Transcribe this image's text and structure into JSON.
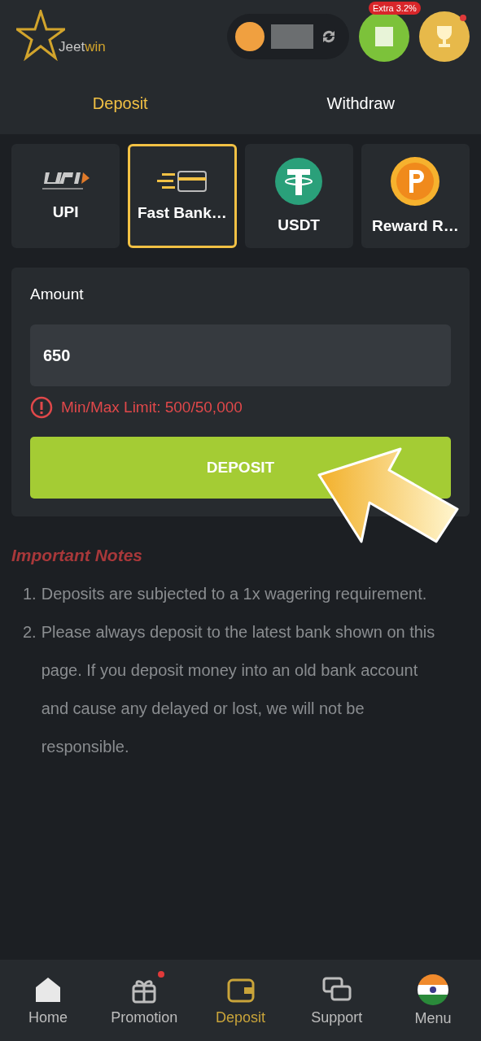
{
  "header": {
    "logo": {
      "part_1": "Jeet",
      "part_2": "win"
    },
    "badge": "Extra 3.2%"
  },
  "tabs": [
    {
      "label": "Deposit",
      "selected": true
    },
    {
      "label": "Withdraw",
      "selected": false
    }
  ],
  "methods": [
    {
      "kind": "upi",
      "label": "UPI",
      "selected": false
    },
    {
      "kind": "bank",
      "label": "Fast Bank…",
      "selected": true
    },
    {
      "kind": "usdt",
      "label": "USDT",
      "selected": false
    },
    {
      "kind": "reward",
      "label": "Reward R…",
      "selected": false
    }
  ],
  "form": {
    "label": "Amount",
    "value": "650",
    "error": "Min/Max Limit: 500/50,000",
    "button": "DEPOSIT"
  },
  "notes": {
    "title": "Important Notes",
    "items": [
      {
        "number": "1.",
        "text": "Deposits are subjected to a 1x wagering requirement."
      },
      {
        "number": "2.",
        "text": "Please always deposit to the latest bank shown on this page. If you deposit money into an old bank account and cause any delayed or lost, we will not be responsible."
      }
    ]
  },
  "nav": [
    {
      "kind": "home",
      "label": "Home",
      "selected": false,
      "dot": false
    },
    {
      "kind": "gift",
      "label": "Promotion",
      "selected": false,
      "dot": true
    },
    {
      "kind": "wallet",
      "label": "Deposit",
      "selected": true,
      "dot": false
    },
    {
      "kind": "chat",
      "label": "Support",
      "selected": false,
      "dot": false
    },
    {
      "kind": "flag",
      "label": "Menu",
      "selected": false,
      "dot": false
    }
  ]
}
